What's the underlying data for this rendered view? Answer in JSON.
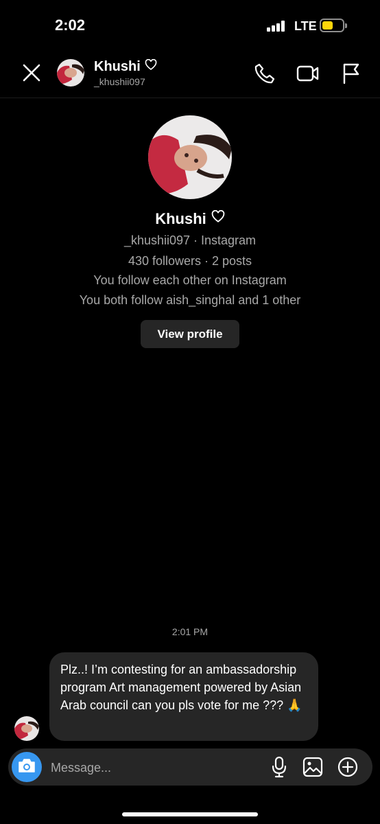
{
  "status_bar": {
    "time": "2:02",
    "network": "LTE",
    "battery_level": 0.55
  },
  "header": {
    "name": "Khushi",
    "username": "_khushii097",
    "icons": [
      "close-icon",
      "heart-icon",
      "phone-icon",
      "video-icon",
      "flag-icon"
    ]
  },
  "profile": {
    "name": "Khushi",
    "meta": "_khushii097 · Instagram",
    "stats": "430 followers · 2 posts",
    "mutual": "You follow each other on Instagram",
    "shared": "You both follow aish_singhal and 1 other",
    "view_profile_label": "View profile"
  },
  "thread": {
    "timestamp": "2:01 PM",
    "messages": [
      {
        "text": "Plz..! I’m contesting for an ambassadorship program Art management powered by Asian Arab council can you pls vote for me ??? 🙏"
      }
    ]
  },
  "composer": {
    "placeholder": "Message...",
    "icons": [
      "camera-icon",
      "microphone-icon",
      "gallery-icon",
      "plus-icon"
    ]
  },
  "colors": {
    "background": "#000000",
    "surface": "#262626",
    "accent": "#3797f0",
    "muted": "#a8a8a8"
  }
}
